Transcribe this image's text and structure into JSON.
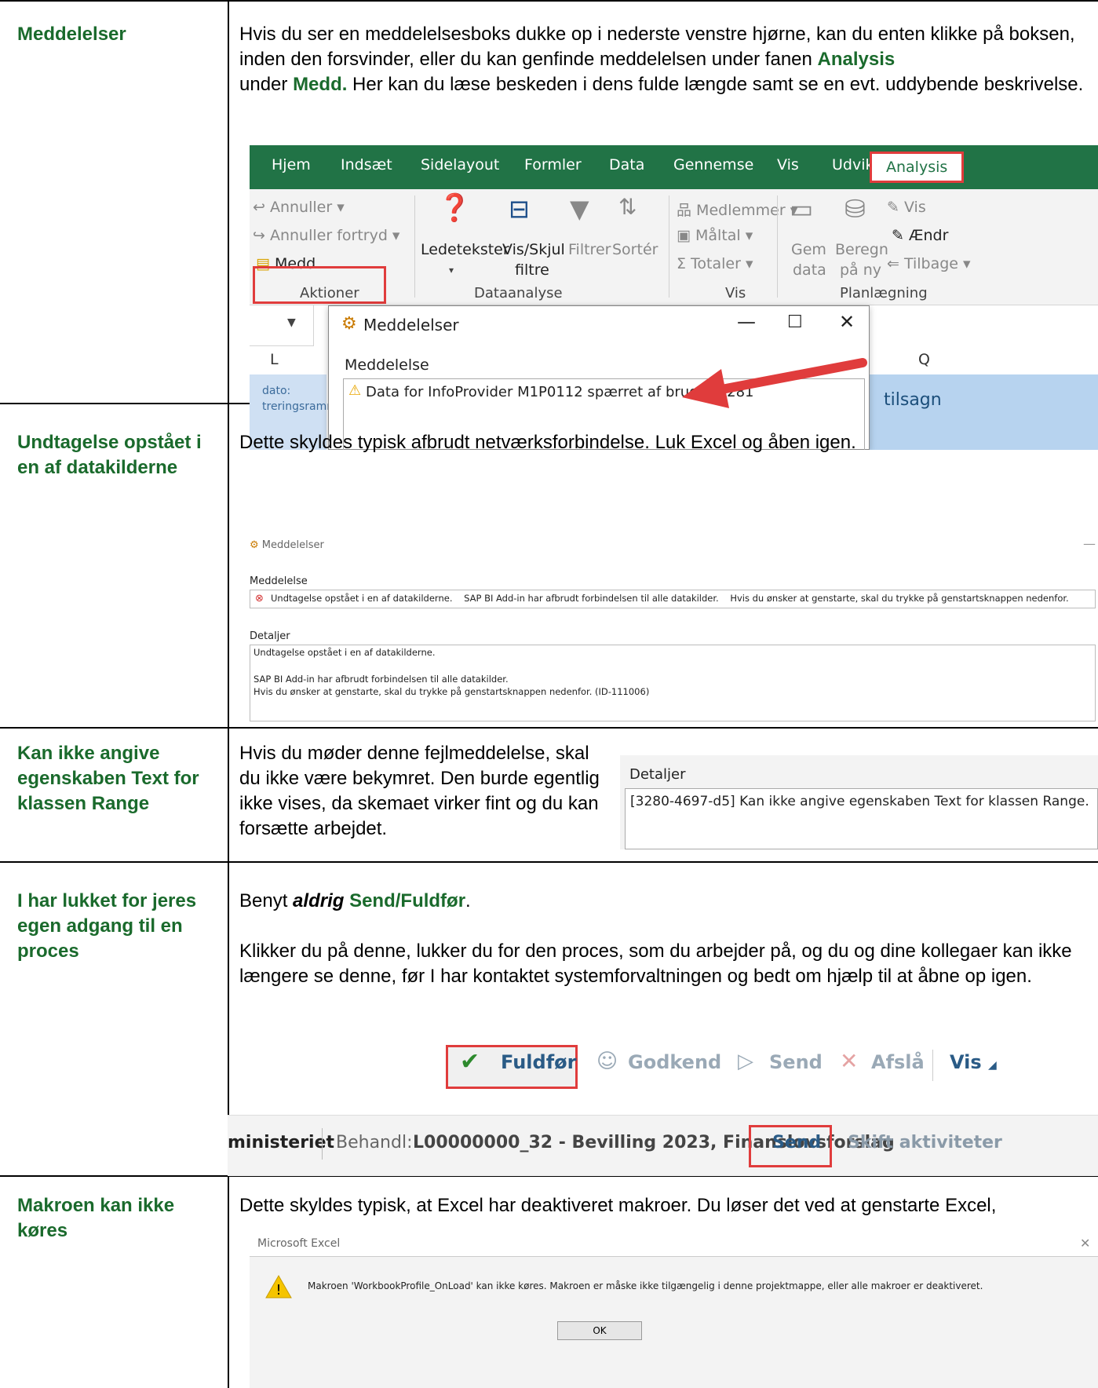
{
  "rows": [
    {
      "heading": "Meddelelser",
      "body_parts": {
        "p1": "Hvis du ser en meddelelsesboks dukke op i nederste venstre hjørne, kan du enten klikke på boksen, inden den forsvinder, eller du kan genfinde meddelelsen under fanen ",
        "analysis": "Analysis",
        "p2": " under ",
        "medd": "Medd.",
        "p3": " Her kan du læse beskeden i dens fulde længde samt se en evt. uddybende beskrivelse."
      }
    },
    {
      "heading": "Undtagelse opstået i en af datakilderne",
      "body": "Dette skyldes typisk afbrudt netværksforbindelse. Luk Excel og åben igen."
    },
    {
      "heading": "Kan ikke angive egenskaben Text for klassen Range",
      "body": "Hvis du møder denne fejlmeddelelse, skal du ikke være bekymret. Den burde egentlig ikke vises, da skemaet virker fint og du kan forsætte arbejdet."
    },
    {
      "heading": "I har lukket for jeres egen adgang til en proces",
      "body_parts": {
        "benyt": "Benyt ",
        "aldrig": "aldrig",
        "send": "Send/Fuldfør",
        "dot": ".",
        "p2": "Klikker du på denne, lukker du for den proces, som du arbejder på, og du og dine kollegaer kan ikke længere se denne, før I har kontaktet systemforvaltningen og bedt om hjælp til at åbne op igen."
      }
    },
    {
      "heading": "Makroen kan ikke køres",
      "body": "Dette skyldes typisk, at Excel har deaktiveret makroer. Du løser det ved at genstarte Excel,"
    }
  ],
  "ribbon": {
    "tabs": [
      "Hjem",
      "Indsæt",
      "Sidelayout",
      "Formler",
      "Data",
      "Gennemse",
      "Vis",
      "Udvikler",
      "Analysis"
    ],
    "annuller": "Annuller",
    "annuller_fortryd": "Annuller fortryd",
    "medd": "Medd.",
    "aktioner": "Aktioner",
    "ledetekster": "Ledetekster",
    "vis_skjul": "Vis/Skjul",
    "filtre": "filtre",
    "filtrer": "Filtrer",
    "sorter": "Sortér",
    "dataanalyse": "Dataanalyse",
    "medlemmer": "Medlemmer",
    "maltal": "Måltal",
    "totaler": "Totaler",
    "vis_group": "Vis",
    "gem": "Gem",
    "data": "data",
    "beregn": "Beregn",
    "pa_ny": "på ny",
    "vis_btn": "Vis",
    "aendr": "Ændr",
    "tilbage": "Tilbage",
    "planlaegning": "Planlægning"
  },
  "sheet": {
    "col_l": "L",
    "col_q": "Q",
    "dato": "dato:",
    "ramme": "treringsramm",
    "tilsagn": "tilsagn"
  },
  "dialog1": {
    "title": "Meddelelser",
    "label": "Meddelelse",
    "msg": "Data for InfoProvider M1P0112 spærret af bruger B281"
  },
  "dialog2": {
    "title": "Meddelelser",
    "label": "Meddelelse",
    "msg": "Undtagelse opstået i en af datakilderne.    SAP BI Add-in har afbrudt forbindelsen til alle datakilder.    Hvis du ønsker at genstarte, skal du trykke på genstartsknappen nedenfor.",
    "details_label": "Detaljer",
    "d1": "Undtagelse opstået i en af datakilderne.",
    "d2": "SAP BI Add-in har afbrudt forbindelsen til alle datakilder.",
    "d3": "Hvis du ønsker at genstarte, skal du trykke på genstartsknappen nedenfor. (ID-111006)"
  },
  "details3": {
    "label": "Detaljer",
    "text": "[3280-4697-d5] Kan ikke angive egenskaben Text for klassen Range."
  },
  "toolbar": {
    "fuldfor": "Fuldfør",
    "godkend": "Godkend",
    "send": "Send",
    "afsla": "Afslå",
    "vis": "Vis"
  },
  "statusbar": {
    "ministeriet": "ministeriet",
    "behandl": "Behandl:",
    "process": "L00000000_32 - Bevilling 2023, Finanslovsforslag",
    "send": "Send",
    "skift": "Skift aktiviteter"
  },
  "macro_dialog": {
    "title": "Microsoft Excel",
    "msg": "Makroen 'WorkbookProfile_OnLoad' kan ikke køres. Makroen er måske ikke tilgængelig i denne projektmappe, eller alle makroer er deaktiveret.",
    "ok": "OK"
  },
  "colors": {
    "heading_green": "#1a6a2c",
    "excel_green": "#217346",
    "highlight_red": "#e03c3c"
  }
}
